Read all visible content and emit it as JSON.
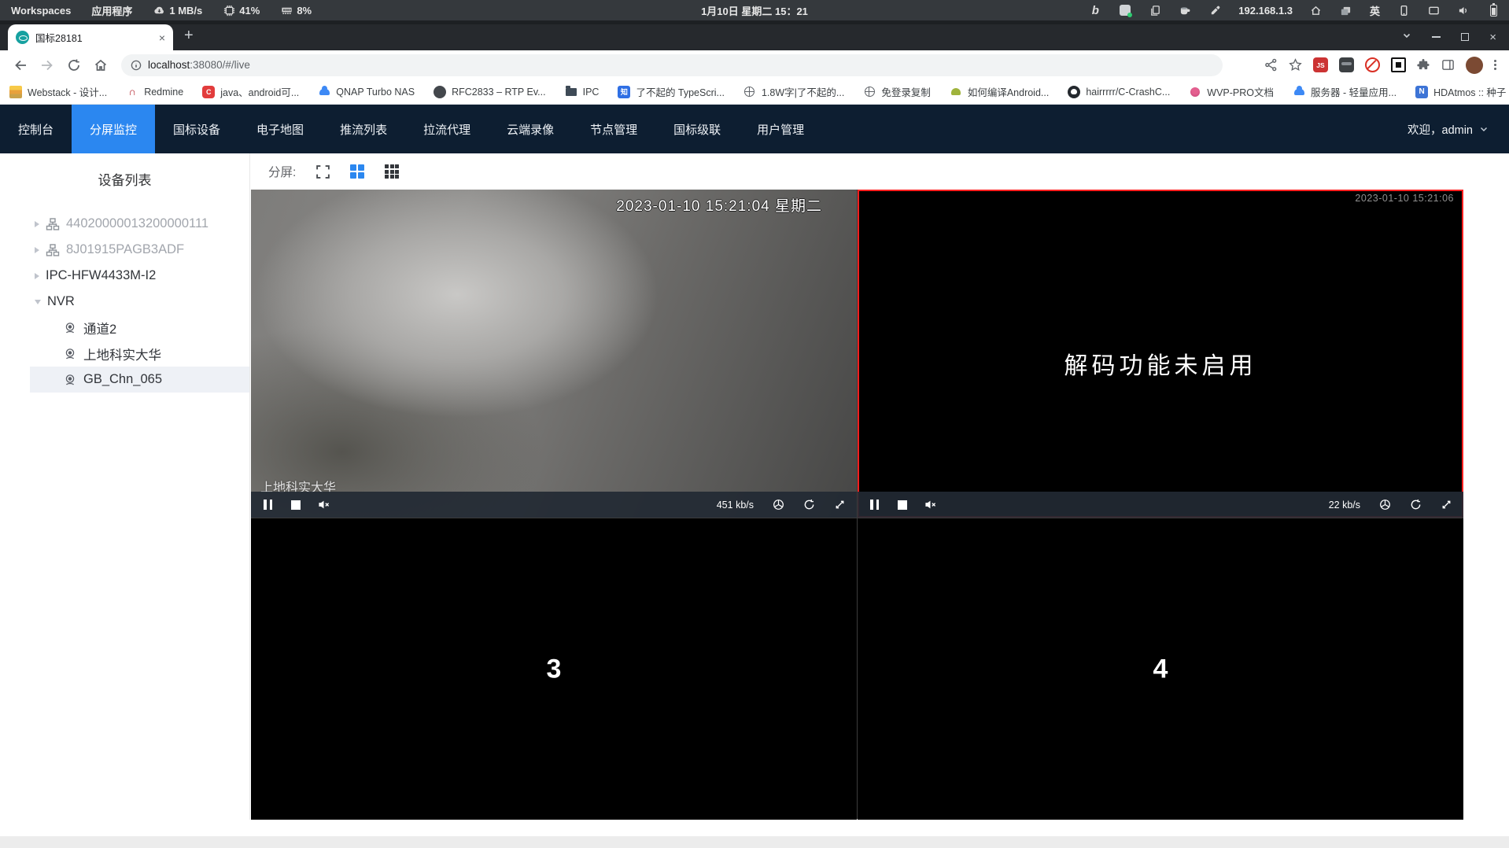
{
  "system_bar": {
    "workspaces_label": "Workspaces",
    "applications_label": "应用程序",
    "net_speed": "1 MB/s",
    "cpu_percent": "41%",
    "mem_percent": "8%",
    "clock": "1月10日 星期二 15：21",
    "ip_address": "192.168.1.3",
    "input_method": "英"
  },
  "browser": {
    "tab_title": "国标28181",
    "url_host": "localhost",
    "url_rest": ":38080/#/live",
    "js_badge": "JS",
    "bookmarks": [
      {
        "label": "Webstack - 设计...",
        "icon": "webstack-icon"
      },
      {
        "label": "Redmine",
        "icon": "redmine-icon"
      },
      {
        "label": "java、android可...",
        "icon": "csdn-icon",
        "glyph": "C"
      },
      {
        "label": "QNAP Turbo NAS",
        "icon": "qnap-cloud-icon"
      },
      {
        "label": "RFC2833 – RTP Ev...",
        "icon": "globe-dark-icon"
      },
      {
        "label": "IPC",
        "icon": "folder-icon"
      },
      {
        "label": "了不起的 TypeScri...",
        "icon": "zhihu-icon",
        "glyph": "知"
      },
      {
        "label": "1.8W字|了不起的...",
        "icon": "globe-icon"
      },
      {
        "label": "免登录复制",
        "icon": "globe-icon"
      },
      {
        "label": "如何编译Android...",
        "icon": "android-icon"
      },
      {
        "label": "hairrrrr/C-CrashC...",
        "icon": "github-icon"
      },
      {
        "label": "WVP-PRO文档",
        "icon": "wvp-icon"
      },
      {
        "label": "服务器 - 轻量应用...",
        "icon": "cloud-icon"
      },
      {
        "label": "HDAtmos :: 种子 *...",
        "icon": "n-icon",
        "glyph": "N"
      }
    ],
    "bookmarks_overflow": "»"
  },
  "nav": {
    "items": [
      {
        "label": "控制台",
        "active": false
      },
      {
        "label": "分屏监控",
        "active": true
      },
      {
        "label": "国标设备",
        "active": false
      },
      {
        "label": "电子地图",
        "active": false
      },
      {
        "label": "推流列表",
        "active": false
      },
      {
        "label": "拉流代理",
        "active": false
      },
      {
        "label": "云端录像",
        "active": false
      },
      {
        "label": "节点管理",
        "active": false
      },
      {
        "label": "国标级联",
        "active": false
      },
      {
        "label": "用户管理",
        "active": false
      }
    ],
    "welcome": "欢迎，admin"
  },
  "sidebar": {
    "title": "设备列表",
    "tree": [
      {
        "label": "44020000013200000111",
        "state": "offline"
      },
      {
        "label": "8J01915PAGB3ADF",
        "state": "offline"
      },
      {
        "label": "IPC-HFW4433M-I2",
        "state": "online"
      },
      {
        "label": "NVR",
        "state": "expanded"
      },
      {
        "label": "通道2",
        "type": "channel"
      },
      {
        "label": "上地科实大华",
        "type": "channel"
      },
      {
        "label": "GB_Chn_065",
        "type": "channel",
        "selected": true
      }
    ]
  },
  "toolbar": {
    "split_label": "分屏:"
  },
  "players": {
    "p1": {
      "timestamp": "2023-01-10 15:21:04 星期二",
      "channel_name": "上地科实大华",
      "bitrate": "451 kb/s"
    },
    "p2": {
      "timestamp": "2023-01-10 15:21:06",
      "message": "解码功能未启用",
      "bitrate": "22 kb/s"
    },
    "p3": {
      "label": "3"
    },
    "p4": {
      "label": "4"
    }
  },
  "colors": {
    "accent_blue": "#2b87f0",
    "nav_bg": "#0d1e31",
    "selected_cell_red": "#ff1f1f",
    "favicon_teal": "#16a1a0"
  }
}
